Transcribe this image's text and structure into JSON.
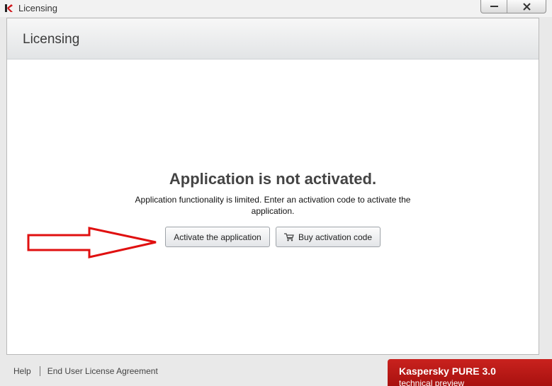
{
  "window": {
    "title": "Licensing",
    "icon": "kaspersky-logo",
    "controls": {
      "minimize": "minimize-icon",
      "close": "close-icon"
    }
  },
  "header": {
    "title": "Licensing"
  },
  "main": {
    "heading": "Application is not activated.",
    "description": "Application functionality is limited. Enter an activation code to activate the application.",
    "buttons": {
      "activate_label": "Activate the application",
      "buy_label": "Buy activation code",
      "buy_icon": "cart-icon"
    }
  },
  "footer": {
    "help_label": "Help",
    "eula_label": "End User License Agreement"
  },
  "product": {
    "name": "Kaspersky PURE 3.0",
    "edition": "technical preview"
  },
  "colors": {
    "brand_red": "#b3140f",
    "annotation_red": "#e01010"
  }
}
